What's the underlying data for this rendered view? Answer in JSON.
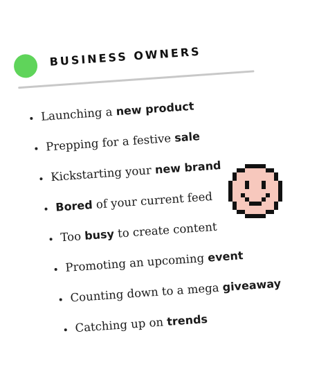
{
  "colors": {
    "accent_dot": "#5fd45a",
    "divider": "#c8c8c8",
    "face_fill": "#f7c8bd",
    "face_outline": "#111111"
  },
  "heading": "BUSINESS OWNERS",
  "items": [
    {
      "pre": "Launching a ",
      "bold": "new product",
      "post": ""
    },
    {
      "pre": "Prepping for a festive ",
      "bold": "sale",
      "post": ""
    },
    {
      "pre": "Kickstarting your ",
      "bold": "new brand",
      "post": ""
    },
    {
      "pre": "",
      "bold": "Bored",
      "post": " of your current feed"
    },
    {
      "pre": "Too ",
      "bold": "busy",
      "post": " to create content"
    },
    {
      "pre": "Promoting an upcoming ",
      "bold": "event",
      "post": ""
    },
    {
      "pre": "Counting down to a mega ",
      "bold": "giveaway",
      "post": ""
    },
    {
      "pre": "Catching up on ",
      "bold": "trends",
      "post": ""
    }
  ],
  "icons": {
    "face": "pixel-smiley-face-icon",
    "dot": "green-circle-icon"
  }
}
